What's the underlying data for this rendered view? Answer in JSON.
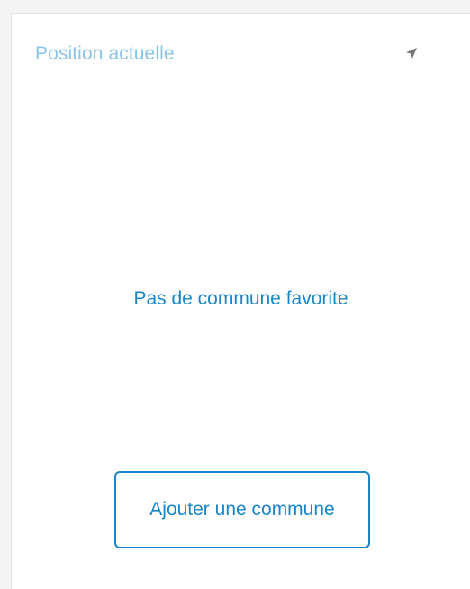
{
  "location": {
    "label": "Position actuelle",
    "icon": "navigation-arrow-icon"
  },
  "favorites": {
    "empty_message": "Pas de commune favorite",
    "add_button_label": "Ajouter une commune"
  },
  "colors": {
    "accent": "#1a86c8",
    "accent_light": "#8cc4e8",
    "icon": "#777777"
  }
}
